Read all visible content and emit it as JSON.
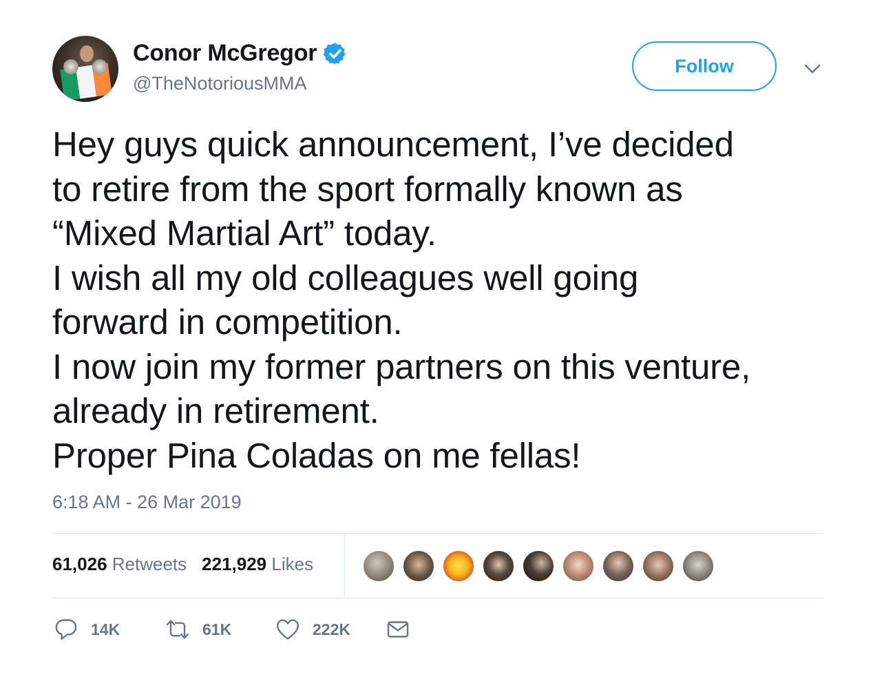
{
  "user": {
    "display_name": "Conor McGregor",
    "handle": "@TheNotoriousMMA",
    "verified": true
  },
  "follow_button_label": "Follow",
  "tweet": {
    "lines": [
      "Hey guys quick announcement, I’ve decided",
      "to retire from the sport formally known as",
      "“Mixed Martial Art” today.",
      "I wish all my old colleagues well going",
      "forward in competition.",
      "I now join my former partners on this venture,",
      "already in retirement.",
      "Proper Pina Coladas on me fellas!"
    ],
    "timestamp": "6:18 AM - 26 Mar 2019"
  },
  "stats": {
    "retweets_count": "61,026",
    "retweets_label": "Retweets",
    "likes_count": "221,929",
    "likes_label": "Likes"
  },
  "likers_count": 9,
  "actions": {
    "reply": "14K",
    "retweet": "61K",
    "like": "222K"
  },
  "colors": {
    "accent": "#1da1f2",
    "secondary_text": "#657786",
    "primary_text": "#14171a",
    "divider": "#e1e8ed"
  }
}
